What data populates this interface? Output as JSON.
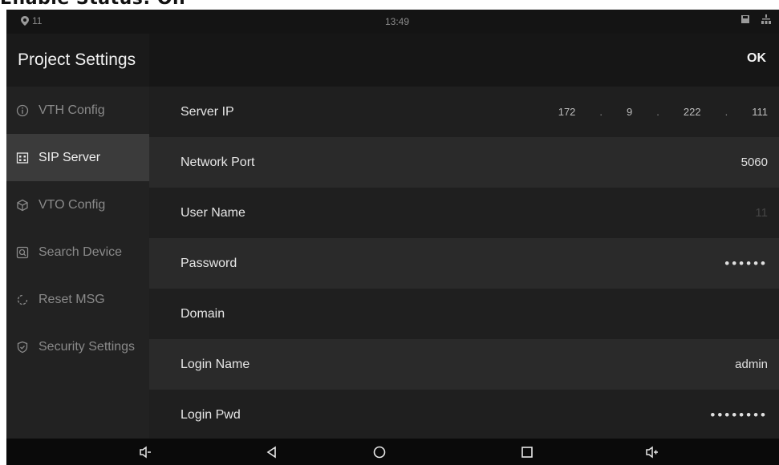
{
  "caption": "Enable Status: On",
  "statusbar": {
    "notification_count": "11",
    "time": "13:49"
  },
  "sidebar": {
    "title": "Project Settings",
    "items": [
      {
        "label": "VTH Config",
        "icon": "info-icon"
      },
      {
        "label": "SIP Server",
        "icon": "building-icon"
      },
      {
        "label": "VTO Config",
        "icon": "cube-icon"
      },
      {
        "label": "Search Device",
        "icon": "search-device-icon"
      },
      {
        "label": "Reset MSG",
        "icon": "reset-icon"
      },
      {
        "label": "Security Settings",
        "icon": "shield-icon"
      }
    ]
  },
  "header": {
    "ok_label": "OK"
  },
  "fields": {
    "server_ip": {
      "label": "Server IP",
      "octets": [
        "172",
        "9",
        "222",
        "111"
      ]
    },
    "network_port": {
      "label": "Network Port",
      "value": "5060"
    },
    "user_name": {
      "label": "User Name",
      "value": "11"
    },
    "password": {
      "label": "Password",
      "value": "••••••"
    },
    "domain": {
      "label": "Domain",
      "value": ""
    },
    "login_name": {
      "label": "Login Name",
      "value": "admin"
    },
    "login_pwd": {
      "label": "Login Pwd",
      "value": "••••••••"
    }
  },
  "colors": {
    "background": "#1f1f1f",
    "sidebar_active": "#3b3b3b",
    "text": "#e6e6e6"
  }
}
